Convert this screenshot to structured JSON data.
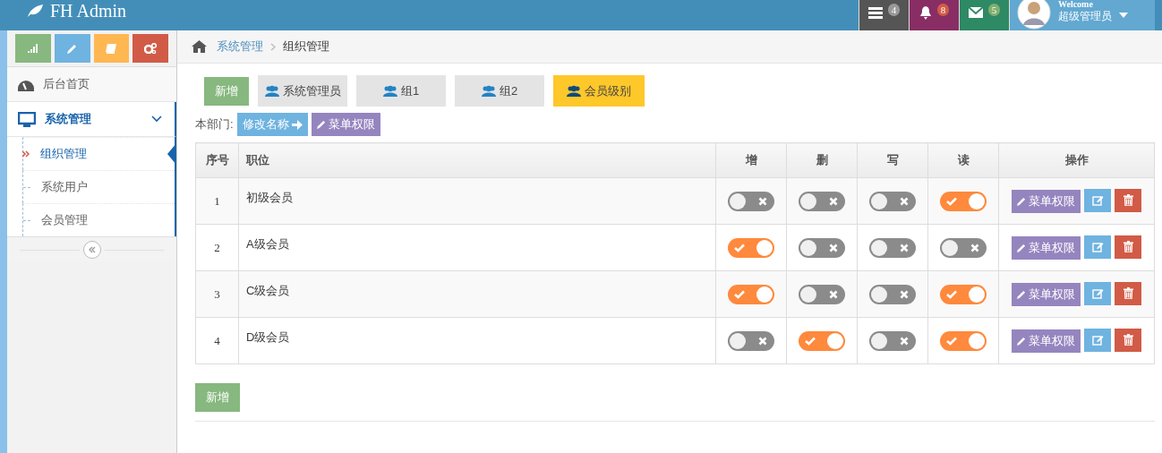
{
  "brand": "FH Admin",
  "nav_badges": [
    {
      "kind": "tasks",
      "count": "4"
    },
    {
      "kind": "bell",
      "count": "8"
    },
    {
      "kind": "mail",
      "count": "5"
    }
  ],
  "user": {
    "greeting": "Welcome",
    "name": "超级管理员"
  },
  "shortcuts": [
    {
      "kind": "chart"
    },
    {
      "kind": "pencil"
    },
    {
      "kind": "book"
    },
    {
      "kind": "gears"
    }
  ],
  "sidebar": {
    "items": [
      {
        "kind": "dashboard",
        "label": "后台首页",
        "expanded": false
      },
      {
        "kind": "monitor",
        "label": "系统管理",
        "expanded": true,
        "children": [
          {
            "label": "组织管理",
            "selected": true
          },
          {
            "label": "系统用户",
            "selected": false
          },
          {
            "label": "会员管理",
            "selected": false
          }
        ]
      }
    ]
  },
  "breadcrumb": {
    "parent": "系统管理",
    "current": "组织管理"
  },
  "add_button": "新增",
  "groups": [
    {
      "label": "系统管理员",
      "selected": false
    },
    {
      "label": "组1",
      "selected": false
    },
    {
      "label": "组2",
      "selected": false
    },
    {
      "label": "会员级别",
      "selected": true
    }
  ],
  "department": {
    "label": "本部门:",
    "rename": "修改名称",
    "menu": "菜单权限"
  },
  "table": {
    "columns": [
      "序号",
      "职位",
      "增",
      "删",
      "写",
      "读",
      "操作"
    ],
    "rows": [
      {
        "no": "1",
        "title": "初级会员",
        "perms": [
          false,
          false,
          false,
          true
        ],
        "menu": "菜单权限"
      },
      {
        "no": "2",
        "title": "A级会员",
        "perms": [
          true,
          false,
          false,
          false
        ],
        "menu": "菜单权限"
      },
      {
        "no": "3",
        "title": "C级会员",
        "perms": [
          true,
          false,
          false,
          true
        ],
        "menu": "菜单权限"
      },
      {
        "no": "4",
        "title": "D级会员",
        "perms": [
          false,
          true,
          false,
          true
        ],
        "menu": "菜单权限"
      }
    ]
  },
  "bottom_button": "新增"
}
